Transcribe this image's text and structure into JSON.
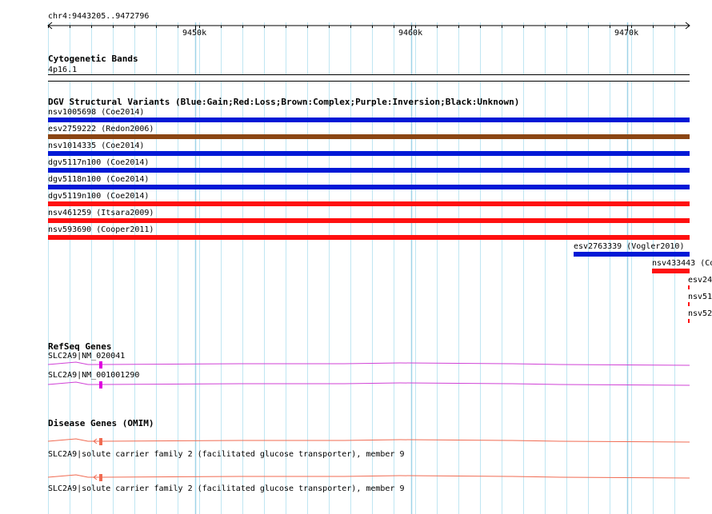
{
  "colors": {
    "grid": "#bfe6f2",
    "gain": "#0019d6",
    "loss": "#ff1010",
    "complex": "#8b4513",
    "refseq": "#d042d6",
    "refseq_exon": "#e000e0",
    "omim": "#f06b52"
  },
  "ruler": {
    "position_label": "chr4:9443205..9472796",
    "ticks": [
      "9450k",
      "9460k",
      "9470k"
    ]
  },
  "cytoband": {
    "title": "Cytogenetic Bands",
    "band_label": "4p16.1"
  },
  "dgv": {
    "title": "DGV Structural Variants (Blue:Gain;Red:Loss;Brown:Complex;Purple:Inversion;Black:Unknown)",
    "variants": [
      {
        "label": "nsv1005698 (Coe2014)",
        "type": "gain"
      },
      {
        "label": "esv2759222 (Redon2006)",
        "type": "complex"
      },
      {
        "label": "nsv1014335 (Coe2014)",
        "type": "gain"
      },
      {
        "label": "dgv5117n100 (Coe2014)",
        "type": "gain"
      },
      {
        "label": "dgv5118n100 (Coe2014)",
        "type": "gain"
      },
      {
        "label": "dgv5119n100 (Coe2014)",
        "type": "loss"
      },
      {
        "label": "nsv461259 (Itsara2009)",
        "type": "loss"
      },
      {
        "label": "nsv593690 (Cooper2011)",
        "type": "loss"
      },
      {
        "label": "esv2763339 (Vogler2010)",
        "type": "gain"
      },
      {
        "label": "nsv433443 (Co",
        "type": "loss"
      },
      {
        "label": "esv24",
        "type": "loss"
      },
      {
        "label": "nsv51",
        "type": "loss"
      },
      {
        "label": "nsv52",
        "type": "loss"
      }
    ]
  },
  "refseq": {
    "title": "RefSeq Genes",
    "transcripts": [
      {
        "label": "SLC2A9|NM_020041"
      },
      {
        "label": "SLC2A9|NM_001001290"
      }
    ]
  },
  "omim": {
    "title": "Disease Genes (OMIM)",
    "entries": [
      {
        "label": "SLC2A9|solute carrier family 2 (facilitated glucose transporter), member 9"
      },
      {
        "label": "SLC2A9|solute carrier family 2 (facilitated glucose transporter), member 9"
      }
    ]
  }
}
